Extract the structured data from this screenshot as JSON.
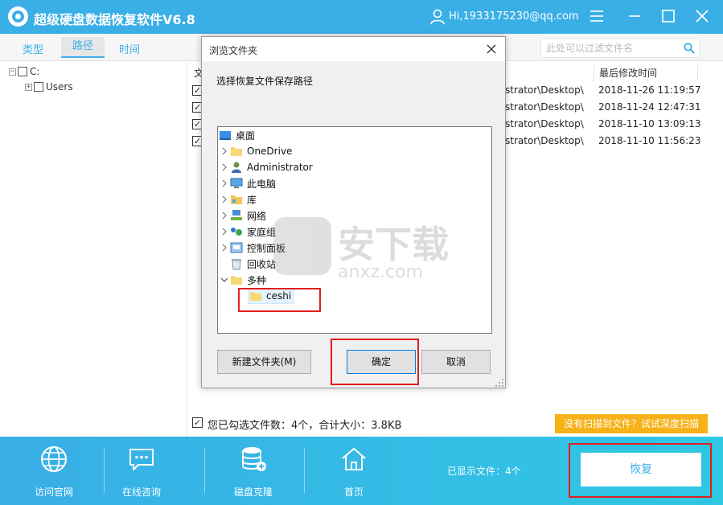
{
  "app": {
    "title": "超级硬盘数据恢复软件V6.8",
    "user_email": "Hi,1933175230@qq.com"
  },
  "tabs": [
    {
      "label": "类型"
    },
    {
      "label": "路径",
      "active": true
    },
    {
      "label": "时间"
    }
  ],
  "filter": {
    "placeholder": "此处可以过滤文件名"
  },
  "tree": {
    "drive": "C:",
    "folder": "Users"
  },
  "table": {
    "col_name_fragment": "文",
    "col_modified": "最后修改时间",
    "rows": [
      {
        "path_fragment": "strator\\Desktop\\",
        "modified": "2018-11-26 11:19:57",
        "checked": true
      },
      {
        "path_fragment": "strator\\Desktop\\",
        "modified": "2018-11-24 12:47:31",
        "checked": true
      },
      {
        "path_fragment": "strator\\Desktop\\",
        "modified": "2018-11-10 13:09:13",
        "checked": true
      },
      {
        "path_fragment": "strator\\Desktop\\",
        "modified": "2018-11-10 11:56:23",
        "checked": true
      }
    ]
  },
  "status": {
    "text": "您已勾选文件数：4个，合计大小：3.8KB",
    "deep_scan": "没有扫描到文件？试试深度扫描"
  },
  "dialog": {
    "title": "浏览文件夹",
    "prompt": "选择恢复文件保存路径",
    "tree": [
      {
        "label": "桌面",
        "icon": "desktop-icon"
      },
      {
        "label": "OneDrive",
        "icon": "folder-icon"
      },
      {
        "label": "Administrator",
        "icon": "user-icon"
      },
      {
        "label": "此电脑",
        "icon": "computer-icon"
      },
      {
        "label": "库",
        "icon": "library-icon"
      },
      {
        "label": "网络",
        "icon": "network-icon"
      },
      {
        "label": "家庭组",
        "icon": "homegroup-icon"
      },
      {
        "label": "控制面板",
        "icon": "control-panel-icon"
      },
      {
        "label": "回收站",
        "icon": "recycle-bin-icon"
      },
      {
        "label": "多种",
        "icon": "folder-icon"
      },
      {
        "label": "ceshi",
        "icon": "folder-icon"
      }
    ],
    "btn_new_folder": "新建文件夹(M)",
    "btn_ok": "确定",
    "btn_cancel": "取消"
  },
  "bottom": {
    "nav": [
      {
        "label": "访问官网",
        "icon": "globe-icon"
      },
      {
        "label": "在线咨询",
        "icon": "chat-icon"
      },
      {
        "label": "磁盘克隆",
        "icon": "disk-clone-icon"
      },
      {
        "label": "首页",
        "icon": "home-icon"
      }
    ],
    "shown_files": "已显示文件：4个",
    "recover": "恢复"
  },
  "watermark": {
    "text": "安下载",
    "sub": "anxz.com"
  },
  "colors": {
    "accent": "#3aafe6",
    "deep_scan_bg": "#f7b218",
    "annotation_red": "#e02020"
  }
}
